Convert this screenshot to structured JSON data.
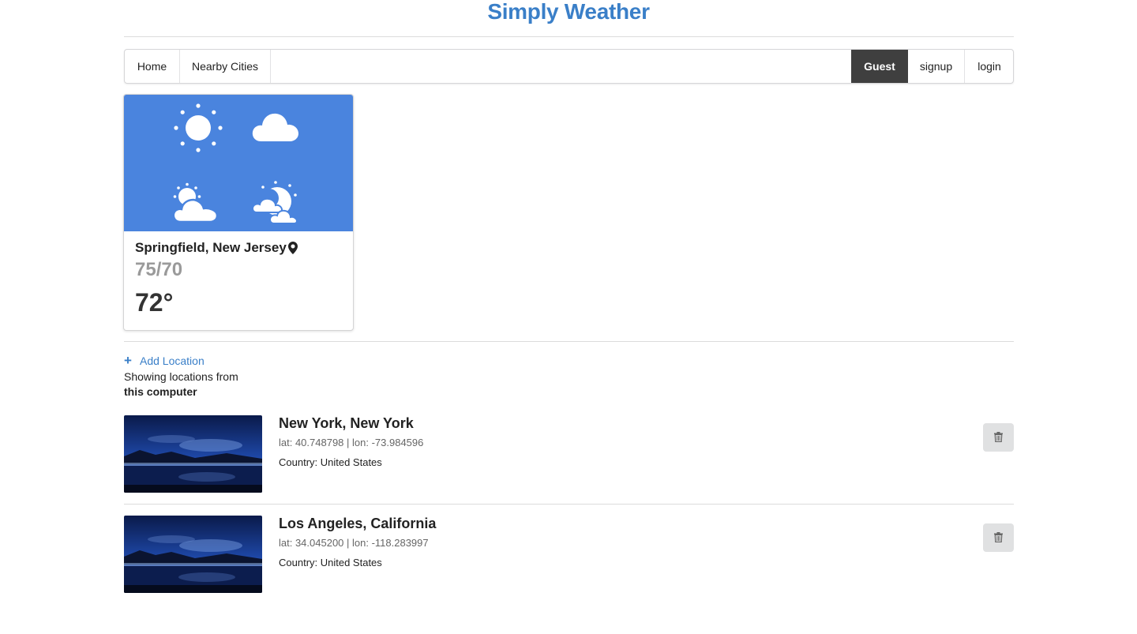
{
  "app": {
    "title": "Simply Weather"
  },
  "nav": {
    "home": "Home",
    "nearby": "Nearby Cities",
    "guest": "Guest",
    "signup": "signup",
    "login": "login"
  },
  "current": {
    "city": "Springfield, New Jersey",
    "hilo": "75/70",
    "temp": "72°",
    "icons": [
      "sun-icon",
      "cloud-icon",
      "partly-cloudy-icon",
      "cloudy-night-icon"
    ],
    "card_color": "#4a84de"
  },
  "locations_panel": {
    "add_label": "Add Location",
    "showing_text": "Showing locations from",
    "showing_source": "this computer"
  },
  "locations": [
    {
      "name": "New York, New York",
      "coords": "lat: 40.748798 | lon: -73.984596",
      "country": "Country: United States"
    },
    {
      "name": "Los Angeles, California",
      "coords": "lat: 34.045200 | lon: -118.283997",
      "country": "Country: United States"
    }
  ],
  "colors": {
    "accent": "#3a7fc8",
    "nav_active": "#3f3f3f"
  }
}
